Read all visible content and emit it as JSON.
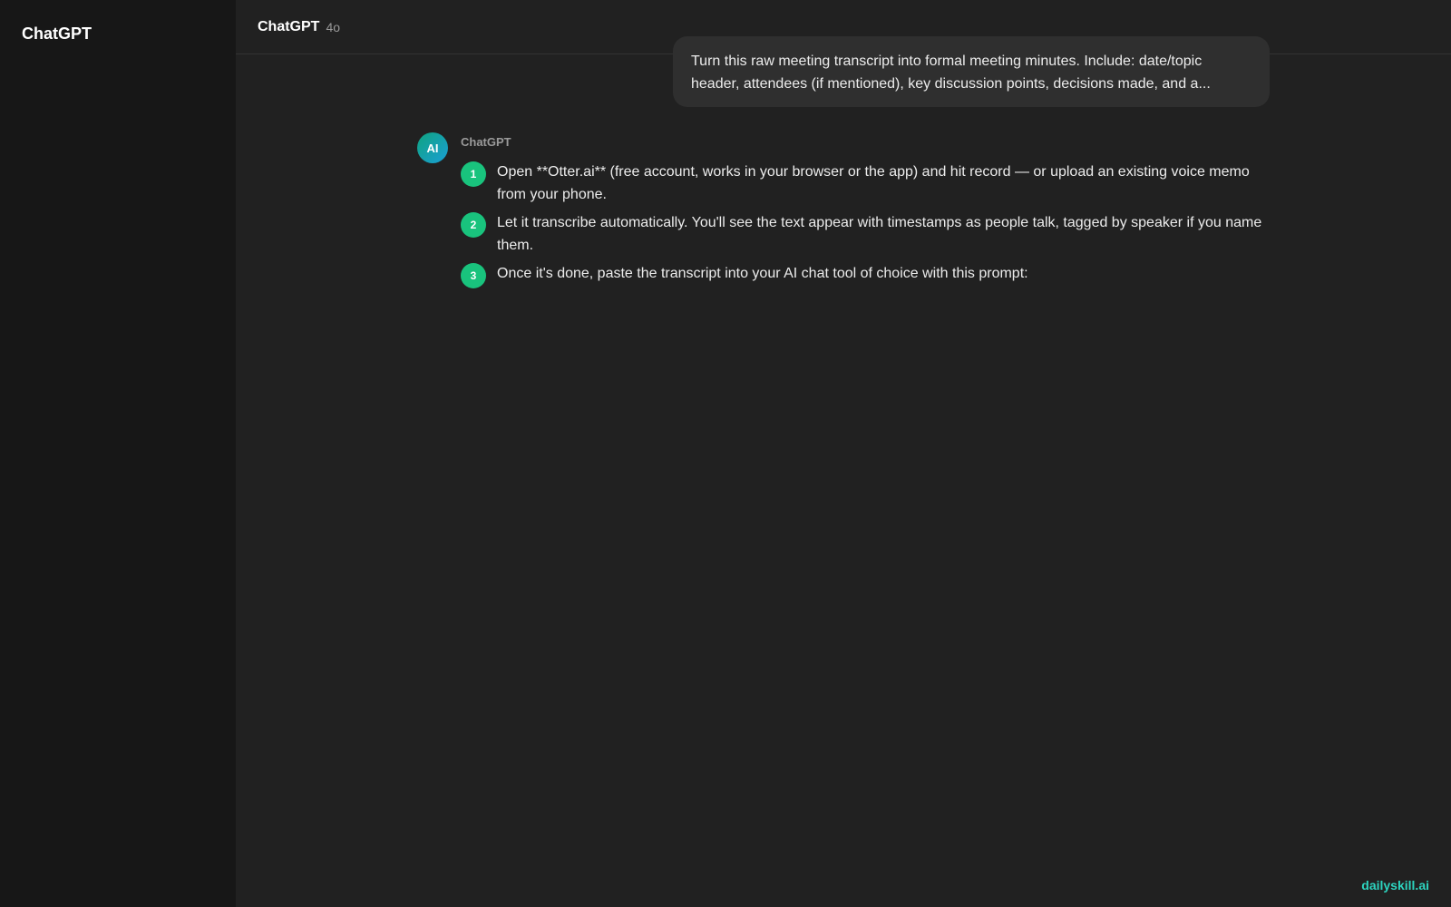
{
  "sidebar": {
    "brand": "ChatGPT"
  },
  "header": {
    "title": "ChatGPT",
    "model": "4o"
  },
  "conversation": {
    "user_message": "Turn this raw meeting transcript into formal meeting minutes. Include: date/topic header, attendees (if mentioned), key discussion points, decisions made, and a...",
    "assistant": {
      "avatar_label": "AI",
      "name": "ChatGPT",
      "steps": [
        {
          "number": "1",
          "text": "Open **Otter.ai** (free account, works in your browser or the app) and hit record — or upload an existing voice memo from your phone."
        },
        {
          "number": "2",
          "text": "Let it transcribe automatically. You'll see the text appear with timestamps as people talk, tagged by speaker if you name them."
        },
        {
          "number": "3",
          "text": "Once it's done, paste the transcript into your AI chat tool of choice with this prompt:"
        }
      ]
    }
  },
  "watermark": "dailyskill.ai",
  "colors": {
    "sidebar_bg": "#171717",
    "main_bg": "#212121",
    "user_bubble": "#2f2f2f",
    "step_badge": "#19c37d",
    "watermark": "#2dd4bf"
  }
}
